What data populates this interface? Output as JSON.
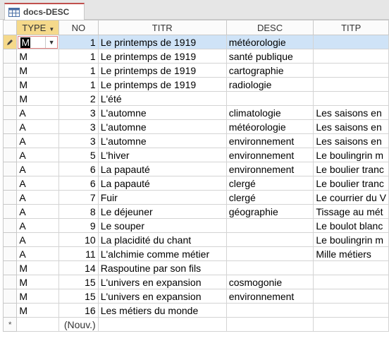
{
  "tab": {
    "label": "docs-DESC"
  },
  "columns": {
    "type": "TYPE",
    "no": "NO",
    "titr": "TITR",
    "desc": "DESC",
    "titp": "TITP"
  },
  "rows": [
    {
      "type": "M",
      "no": "1",
      "titr": "Le printemps de 1919",
      "desc": "météorologie",
      "titp": ""
    },
    {
      "type": "M",
      "no": "1",
      "titr": "Le printemps de 1919",
      "desc": "santé publique",
      "titp": ""
    },
    {
      "type": "M",
      "no": "1",
      "titr": "Le printemps de 1919",
      "desc": "cartographie",
      "titp": ""
    },
    {
      "type": "M",
      "no": "1",
      "titr": "Le printemps de 1919",
      "desc": "radiologie",
      "titp": ""
    },
    {
      "type": "M",
      "no": "2",
      "titr": "L'été",
      "desc": "",
      "titp": ""
    },
    {
      "type": "A",
      "no": "3",
      "titr": "L'automne",
      "desc": "climatologie",
      "titp": "Les saisons en"
    },
    {
      "type": "A",
      "no": "3",
      "titr": "L'automne",
      "desc": "météorologie",
      "titp": "Les saisons en"
    },
    {
      "type": "A",
      "no": "3",
      "titr": "L'automne",
      "desc": "environnement",
      "titp": "Les saisons en"
    },
    {
      "type": "A",
      "no": "5",
      "titr": "L'hiver",
      "desc": "environnement",
      "titp": "Le boulingrin m"
    },
    {
      "type": "A",
      "no": "6",
      "titr": "La papauté",
      "desc": "environnement",
      "titp": "Le boulier tranc"
    },
    {
      "type": "A",
      "no": "6",
      "titr": "La papauté",
      "desc": "clergé",
      "titp": "Le boulier tranc"
    },
    {
      "type": "A",
      "no": "7",
      "titr": "Fuir",
      "desc": "clergé",
      "titp": "Le courrier du V"
    },
    {
      "type": "A",
      "no": "8",
      "titr": "Le déjeuner",
      "desc": "géographie",
      "titp": "Tissage au mét"
    },
    {
      "type": "A",
      "no": "9",
      "titr": "Le souper",
      "desc": "",
      "titp": "Le boulot blanc"
    },
    {
      "type": "A",
      "no": "10",
      "titr": "La placidité du chant",
      "desc": "",
      "titp": "Le boulingrin m"
    },
    {
      "type": "A",
      "no": "11",
      "titr": "L'alchimie comme métier",
      "desc": "",
      "titp": "Mille métiers"
    },
    {
      "type": "M",
      "no": "14",
      "titr": "Raspoutine par son fils",
      "desc": "",
      "titp": ""
    },
    {
      "type": "M",
      "no": "15",
      "titr": "L'univers en expansion",
      "desc": "cosmogonie",
      "titp": ""
    },
    {
      "type": "M",
      "no": "15",
      "titr": "L'univers en expansion",
      "desc": "environnement",
      "titp": ""
    },
    {
      "type": "M",
      "no": "16",
      "titr": "Les métiers du monde",
      "desc": "",
      "titp": ""
    }
  ],
  "new_record": {
    "marker": "*",
    "label": "(Nouv.)"
  }
}
